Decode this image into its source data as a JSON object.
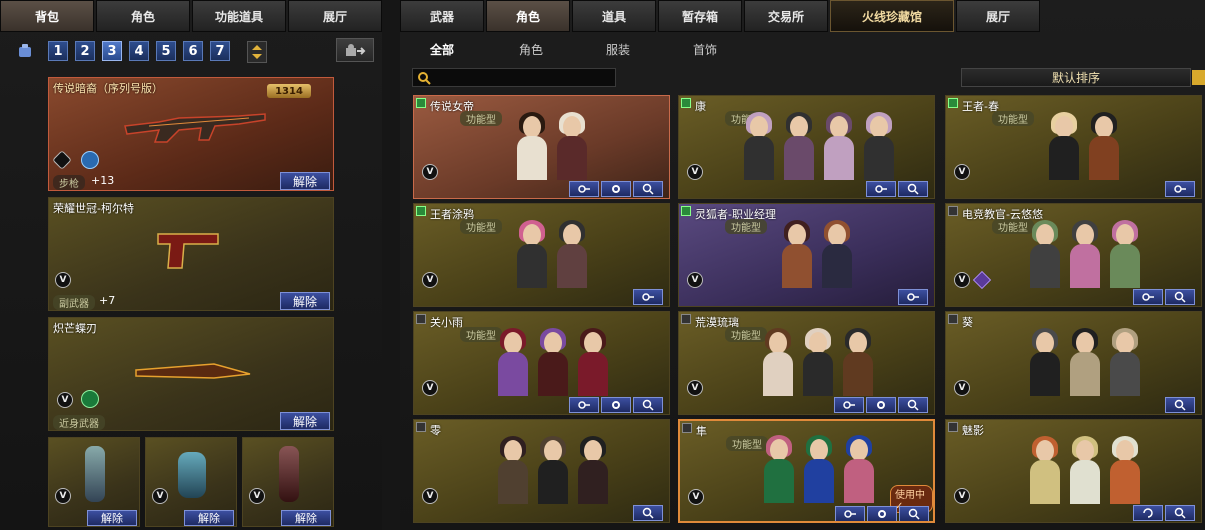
{
  "left_tabs": [
    "背包",
    "角色",
    "功能道具",
    "展厅"
  ],
  "pages": [
    "1",
    "2",
    "3",
    "4",
    "5",
    "6",
    "7"
  ],
  "page_active": "3",
  "inventory": [
    {
      "name": "传说暗裔（序列号版）",
      "serial": "1314",
      "category": "步枪",
      "bonus": "+13",
      "action": "解除"
    },
    {
      "name": "荣耀世冠-柯尔特",
      "category": "副武器",
      "bonus": "+7",
      "action": "解除"
    },
    {
      "name": "炽芒蝶刃",
      "category": "近身武器",
      "action": "解除"
    }
  ],
  "grenades": [
    {
      "action": "解除"
    },
    {
      "action": "解除"
    },
    {
      "action": "解除"
    }
  ],
  "vip_badge": "V",
  "right_tabs": [
    "武器",
    "角色",
    "道具",
    "暂存箱",
    "交易所",
    "火线珍藏馆",
    "展厅"
  ],
  "sub_tabs": [
    "全部",
    "角色",
    "服装",
    "首饰"
  ],
  "sort_label": "默认排序",
  "func_tag": "功能型",
  "in_use_label": "使用中✓",
  "chars": [
    {
      "name": "传说女帝",
      "tag": true,
      "star": true
    },
    {
      "name": "康",
      "tag": true,
      "star": true
    },
    {
      "name": "王者-春",
      "tag": true,
      "star": true
    },
    {
      "name": "王者涂鸦",
      "tag": true,
      "star": true
    },
    {
      "name": "灵狐者-职业经理",
      "tag": true,
      "star": true
    },
    {
      "name": "电竞教官-云悠悠",
      "tag": true,
      "star": false
    },
    {
      "name": "关小雨",
      "tag": true,
      "star": false
    },
    {
      "name": "荒漠琉璃",
      "tag": true,
      "star": false
    },
    {
      "name": "葵",
      "tag": false,
      "star": false
    },
    {
      "name": "零",
      "tag": false,
      "star": false
    },
    {
      "name": "隼",
      "tag": true,
      "star": false
    },
    {
      "name": "魅影",
      "tag": false,
      "star": false
    }
  ]
}
